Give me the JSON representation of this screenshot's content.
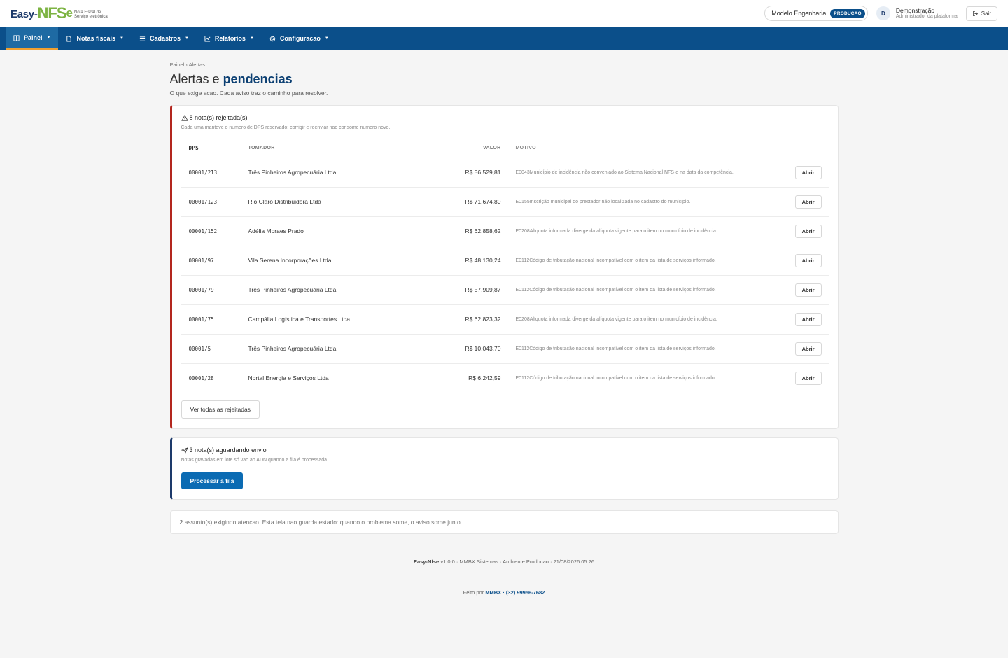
{
  "brand": {
    "easy": "Easy-",
    "nfs": "NFS",
    "e": "e",
    "tagline": "Nota Fiscal de Serviço eletrônica"
  },
  "header": {
    "company": "Modelo Engenharia",
    "env_badge": "PRODUCAO",
    "user_initial": "D",
    "user_name": "Demonstração",
    "user_role": "Administrador da plataforma",
    "logout_label": "Sair"
  },
  "nav": [
    {
      "label": "Painel",
      "icon": "dashboard-icon",
      "active": true
    },
    {
      "label": "Notas fiscais",
      "icon": "document-icon"
    },
    {
      "label": "Cadastros",
      "icon": "list-icon"
    },
    {
      "label": "Relatorios",
      "icon": "chart-icon"
    },
    {
      "label": "Configuracao",
      "icon": "gear-icon"
    }
  ],
  "breadcrumb": "Painel › Alertas",
  "title": {
    "light": "Alertas e",
    "bold": "pendencias"
  },
  "subtitle": "O que exige acao. Cada aviso traz o caminho para resolver.",
  "rejected": {
    "title": "8 nota(s) rejeitada(s)",
    "desc": "Cada uma manteve o numero de DPS reservado: corrigir e reenviar nao consome numero novo.",
    "columns": {
      "dps": "DPS",
      "tomador": "TOMADOR",
      "valor": "VALOR",
      "motivo": "MOTIVO"
    },
    "open_label": "Abrir",
    "rows": [
      {
        "dps": "00001/213",
        "tomador": "Três Pinheiros Agropecuária Ltda",
        "valor": "R$ 56.529,81",
        "motivo": "E0043Município de incidência não conveniado ao Sistema Nacional NFS-e na data da competência."
      },
      {
        "dps": "00001/123",
        "tomador": "Rio Claro Distribuidora Ltda",
        "valor": "R$ 71.674,80",
        "motivo": "E0155Inscrição municipal do prestador não localizada no cadastro do município."
      },
      {
        "dps": "00001/152",
        "tomador": "Adélia Moraes Prado",
        "valor": "R$ 62.858,62",
        "motivo": "E0208Alíquota informada diverge da alíquota vigente para o item no município de incidência."
      },
      {
        "dps": "00001/97",
        "tomador": "Vila Serena Incorporações Ltda",
        "valor": "R$ 48.130,24",
        "motivo": "E0112Código de tributação nacional incompatível com o item da lista de serviços informado."
      },
      {
        "dps": "00001/79",
        "tomador": "Três Pinheiros Agropecuária Ltda",
        "valor": "R$ 57.909,87",
        "motivo": "E0112Código de tributação nacional incompatível com o item da lista de serviços informado."
      },
      {
        "dps": "00001/75",
        "tomador": "Campália Logística e Transportes Ltda",
        "valor": "R$ 62.823,32",
        "motivo": "E0208Alíquota informada diverge da alíquota vigente para o item no município de incidência."
      },
      {
        "dps": "00001/5",
        "tomador": "Três Pinheiros Agropecuária Ltda",
        "valor": "R$ 10.043,70",
        "motivo": "E0112Código de tributação nacional incompatível com o item da lista de serviços informado."
      },
      {
        "dps": "00001/28",
        "tomador": "Nortal Energia e Serviços Ltda",
        "valor": "R$ 6.242,59",
        "motivo": "E0112Código de tributação nacional incompatível com o item da lista de serviços informado."
      }
    ],
    "view_all_label": "Ver todas as rejeitadas"
  },
  "waiting": {
    "title": "3 nota(s) aguardando envio",
    "desc": "Notas gravadas em lote só vao ao ADN quando a fila é processada.",
    "action_label": "Processar a fila"
  },
  "summary": {
    "count": "2",
    "text": " assunto(s) exigindo atencao. Esta tela nao guarda estado: quando o problema some, o aviso some junto."
  },
  "footer": {
    "app": "Easy-Nfse",
    "rest": " v1.0.0 · MMBX Sistemas · Ambiente Producao · 21/08/2026 05:26",
    "made_by": "Feito por ",
    "company": "MMBX",
    "phone": " · (32) 99956-7682"
  },
  "colors": {
    "nav_bg": "#0b4f8a",
    "accent_red": "#b3261e",
    "accent_blue": "#1d3a6b",
    "primary_btn": "#0b6bb3",
    "brand_green": "#7cb342"
  }
}
